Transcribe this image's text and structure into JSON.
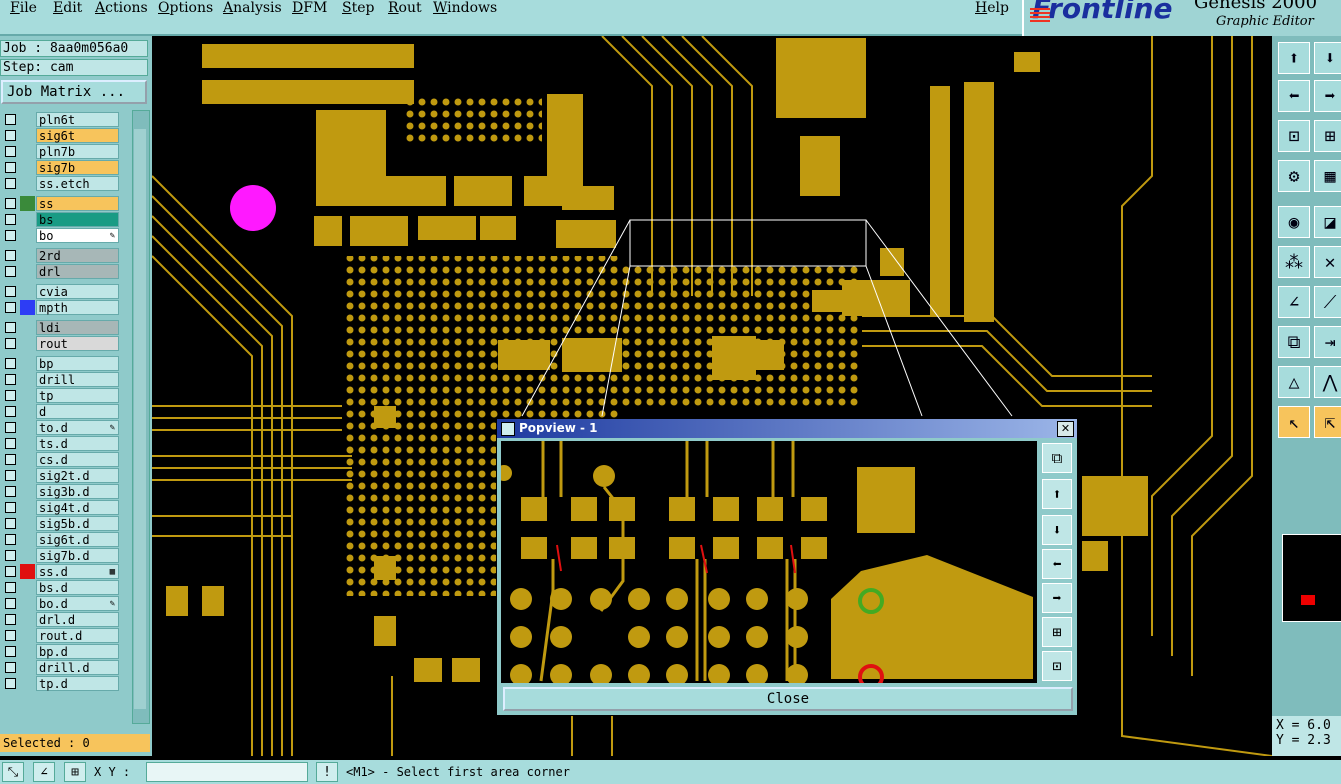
{
  "menu": [
    "File",
    "Edit",
    "Actions",
    "Options",
    "Analysis",
    "DFM",
    "Step",
    "Rout",
    "Windows"
  ],
  "help": "Help",
  "brand": {
    "logo": "Frontline",
    "product": "Genesis 2000",
    "subtitle": "Graphic Editor"
  },
  "job": "Job : 8aa0m056a0",
  "step": "Step: cam",
  "job_matrix": "Job Matrix ...",
  "layers": [
    {
      "name": "pln6t",
      "color": "#bfe6e6",
      "swatch": ""
    },
    {
      "name": "sig6t",
      "color": "#f7c45c",
      "swatch": ""
    },
    {
      "name": "pln7b",
      "color": "#bfe6e6",
      "swatch": ""
    },
    {
      "name": "sig7b",
      "color": "#f7c45c",
      "swatch": ""
    },
    {
      "name": "ss.etch",
      "color": "#bfe6e6",
      "swatch": ""
    },
    {
      "name": "ss",
      "color": "#f7c45c",
      "swatch": "#3a8a3a"
    },
    {
      "name": "bs",
      "color": "#199b84",
      "swatch": ""
    },
    {
      "name": "bo",
      "color": "#ffffff",
      "swatch": "",
      "tag": "✎"
    },
    {
      "name": "2rd",
      "color": "#a7b7b7",
      "swatch": ""
    },
    {
      "name": "drl",
      "color": "#a7b7b7",
      "swatch": ""
    },
    {
      "name": "cvia",
      "color": "#bfe6e6",
      "swatch": ""
    },
    {
      "name": "mpth",
      "color": "#bfe6e6",
      "swatch": "#2d3df5"
    },
    {
      "name": "ldi",
      "color": "#a7b7b7",
      "swatch": ""
    },
    {
      "name": "rout",
      "color": "#d9d9d9",
      "swatch": ""
    },
    {
      "name": "bp",
      "color": "#bfe6e6",
      "swatch": ""
    },
    {
      "name": "drill",
      "color": "#bfe6e6",
      "swatch": ""
    },
    {
      "name": "tp",
      "color": "#bfe6e6",
      "swatch": ""
    },
    {
      "name": "d",
      "color": "#bfe6e6",
      "swatch": ""
    },
    {
      "name": "to.d",
      "color": "#bfe6e6",
      "swatch": "",
      "tag": "✎"
    },
    {
      "name": "ts.d",
      "color": "#bfe6e6",
      "swatch": ""
    },
    {
      "name": "cs.d",
      "color": "#bfe6e6",
      "swatch": ""
    },
    {
      "name": "sig2t.d",
      "color": "#bfe6e6",
      "swatch": ""
    },
    {
      "name": "sig3b.d",
      "color": "#bfe6e6",
      "swatch": ""
    },
    {
      "name": "sig4t.d",
      "color": "#bfe6e6",
      "swatch": ""
    },
    {
      "name": "sig5b.d",
      "color": "#bfe6e6",
      "swatch": ""
    },
    {
      "name": "sig6t.d",
      "color": "#bfe6e6",
      "swatch": ""
    },
    {
      "name": "sig7b.d",
      "color": "#bfe6e6",
      "swatch": ""
    },
    {
      "name": "ss.d",
      "color": "#bfe6e6",
      "swatch": "#e01010",
      "tag": "▦"
    },
    {
      "name": "bs.d",
      "color": "#bfe6e6",
      "swatch": ""
    },
    {
      "name": "bo.d",
      "color": "#bfe6e6",
      "swatch": "",
      "tag": "✎"
    },
    {
      "name": "drl.d",
      "color": "#bfe6e6",
      "swatch": ""
    },
    {
      "name": "rout.d",
      "color": "#bfe6e6",
      "swatch": ""
    },
    {
      "name": "bp.d",
      "color": "#bfe6e6",
      "swatch": ""
    },
    {
      "name": "drill.d",
      "color": "#bfe6e6",
      "swatch": ""
    },
    {
      "name": "tp.d",
      "color": "#bfe6e6",
      "swatch": ""
    }
  ],
  "selected": "Selected : 0",
  "coords": {
    "x": "X = 6.0",
    "y": "Y = 2.3"
  },
  "status": {
    "xy_label": "X Y :",
    "xy_value": "",
    "message": "<M1> - Select first area corner"
  },
  "popview": {
    "title": "Popview - 1",
    "close": "Close"
  },
  "colors": {
    "copper": "#c09a10",
    "board": "#000000",
    "panel": "#8fcaca",
    "highlight": "#f7c45c"
  }
}
